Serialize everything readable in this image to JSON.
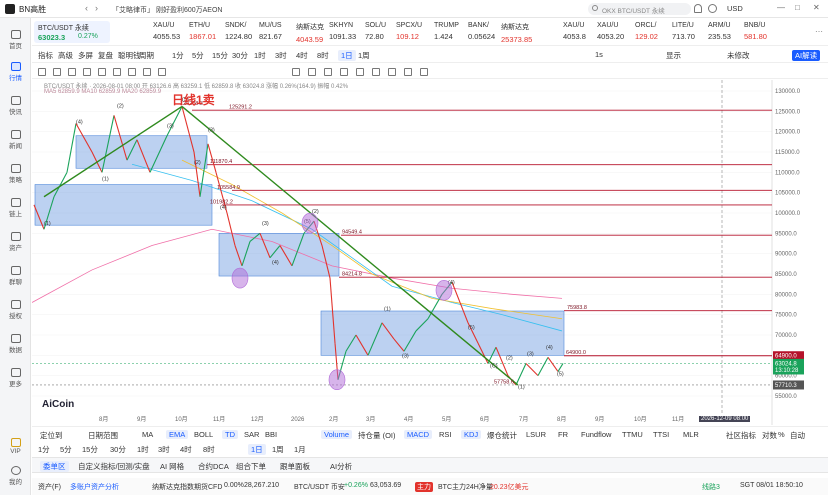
{
  "app": {
    "brand": "BN高胜",
    "notice": "「艾略律币」 刚好盈利600万AEON",
    "search_placeholder": "OKX BTC/USDT 永续",
    "currency": "USD",
    "window_controls": [
      "—",
      "□",
      "✕"
    ]
  },
  "rail": [
    {
      "label": "首页"
    },
    {
      "label": "行情"
    },
    {
      "label": "快讯"
    },
    {
      "label": "新闻"
    },
    {
      "label": "策略"
    },
    {
      "label": "链上"
    },
    {
      "label": "资产"
    },
    {
      "label": "群聊"
    },
    {
      "label": "授权"
    },
    {
      "label": "数据"
    },
    {
      "label": "更多"
    },
    {
      "label": "VIP"
    },
    {
      "label": "我的"
    }
  ],
  "tickers": [
    {
      "name": "BTC/USDT 永续",
      "price": "63023.3",
      "chg": "0.27%"
    },
    {
      "name": "XAU/U",
      "price": "4055.53"
    },
    {
      "name": "ETH/U",
      "price": "1867.01"
    },
    {
      "name": "SNDK/",
      "price": "1224.80"
    },
    {
      "name": "MU/US",
      "price": "821.67"
    },
    {
      "name": "纳斯达克",
      "price": "4043.59"
    },
    {
      "name": "SKHYN",
      "price": "1091.33"
    },
    {
      "name": "SOL/U",
      "price": "72.80"
    },
    {
      "name": "SPCX/U",
      "price": "109.12"
    },
    {
      "name": "TRUMP",
      "price": "1.424"
    },
    {
      "name": "BANK/",
      "price": "0.05624"
    },
    {
      "name": "纳斯达克",
      "price": "25373.85"
    },
    {
      "name": "XAU/U",
      "price": "4053.8"
    },
    {
      "name": "XAU/U",
      "price": "4053.20"
    },
    {
      "name": "ORCL/",
      "price": "129.02"
    },
    {
      "name": "LITE/U",
      "price": "713.70"
    },
    {
      "name": "ARM/U",
      "price": "235.53"
    },
    {
      "name": "BNB/U",
      "price": "581.80"
    }
  ],
  "toolbar1": {
    "items": [
      "指标",
      "高级",
      "多屏",
      "复盘",
      "聪明钱",
      "周期",
      "1分",
      "5分",
      "15分",
      "30分",
      "1时",
      "3时",
      "4时",
      "8时",
      "1日",
      "1周"
    ],
    "selected": "1日",
    "right": [
      "未修改",
      "AI解读"
    ],
    "right_ctrl": [
      "1s",
      "显示"
    ]
  },
  "chart": {
    "info": "BTC/USDT 永续 · 2026-08-01 08:00 开 63126.6 高 63259.1 低 62859.8 收 63024.8 涨幅 0.26%(164.9) 振幅 0.42%",
    "ma_line": "MA5 62859.9  MA10 62859.9  MA20 62859.9",
    "title_annotation": "日线1卖",
    "price_levels": [
      "126208.3",
      "125291.2",
      "111870.4",
      "105584.9",
      "101982.2",
      "94549.4",
      "84214.8",
      "75983.8",
      "64900.0",
      "57710.3",
      "57758.6"
    ],
    "wave_labels": [
      "(4)",
      "(2)",
      "(1)",
      "(3)",
      "(5)",
      "(2)",
      "(3)",
      "(4)",
      "(1)",
      "(3)",
      "(4)",
      "(5)",
      "(2)",
      "(1)",
      "(3)",
      "(4)",
      "(5)",
      "(C)",
      "(1)",
      "(2)",
      "(3)",
      "(4)",
      "(5)"
    ],
    "y_axis": [
      "130000.0",
      "125000.0",
      "120000.0",
      "115000.0",
      "110000.0",
      "105000.0",
      "100000.0",
      "95000.0",
      "90000.0",
      "85000.0",
      "80000.0",
      "75000.0",
      "70000.0",
      "65000.0",
      "60000.0",
      "55000.0"
    ],
    "x_axis": [
      "8月",
      "9月",
      "10月",
      "11月",
      "12月",
      "2026",
      "2月",
      "3月",
      "4月",
      "5月",
      "6月",
      "7月",
      "8月",
      "9月",
      "10月",
      "11月"
    ],
    "current_price": "63024.8",
    "countdown": "13:10:28",
    "low_tag": "57710.3",
    "cursor_date": "2026-12-09 08:00",
    "price_tag_2": "64900.0",
    "watermark": "AiCoin"
  },
  "indicators": {
    "left": [
      "定位到",
      "日期范围"
    ],
    "items": [
      "MA",
      "EMA",
      "BOLL",
      "TD",
      "SAR",
      "BBI",
      "Volume",
      "持仓量 (OI)",
      "MACD",
      "RSI",
      "KDJ",
      "爆仓统计",
      "LSUR",
      "FR",
      "Fundflow",
      "TTMU",
      "TTSI",
      "MLR"
    ],
    "right": [
      "社区指标",
      "对数",
      "%",
      "自动"
    ]
  },
  "periods": [
    "1分",
    "5分",
    "15分",
    "30分",
    "1时",
    "3时",
    "4时",
    "8时",
    "1日",
    "1周",
    "1月"
  ],
  "bottom_tabs": [
    "委单区",
    "自定义指标/回测/实盘",
    "AI 网格",
    "合约DCA",
    "组合下单",
    "跟单面板",
    "AI分析"
  ],
  "status": {
    "left": "资产(F)",
    "asset_analysis": "多账户资产分析",
    "nasdaq_cfd": "纳斯达克指数期货CFD",
    "nasdaq_chg": "0.00%",
    "nasdaq_val": "28,267.210",
    "btc_pair": "BTC/USDT 币安",
    "btc_chg": "+0.26%",
    "btc_price": "63,053.69",
    "main_label": "主力",
    "main_text": "BTC主力24H净量",
    "main_val": "20.23亿美元",
    "line": "线路3",
    "time": "SGT 08/01 18:50:10"
  },
  "colors": {
    "accent": "#1a5cff",
    "up": "#1aa35b",
    "down": "#e2332c",
    "box": "#4f87d9",
    "resistance": "#b5122a",
    "trend": "#2f8a1e",
    "marker": "#b06ad8"
  }
}
